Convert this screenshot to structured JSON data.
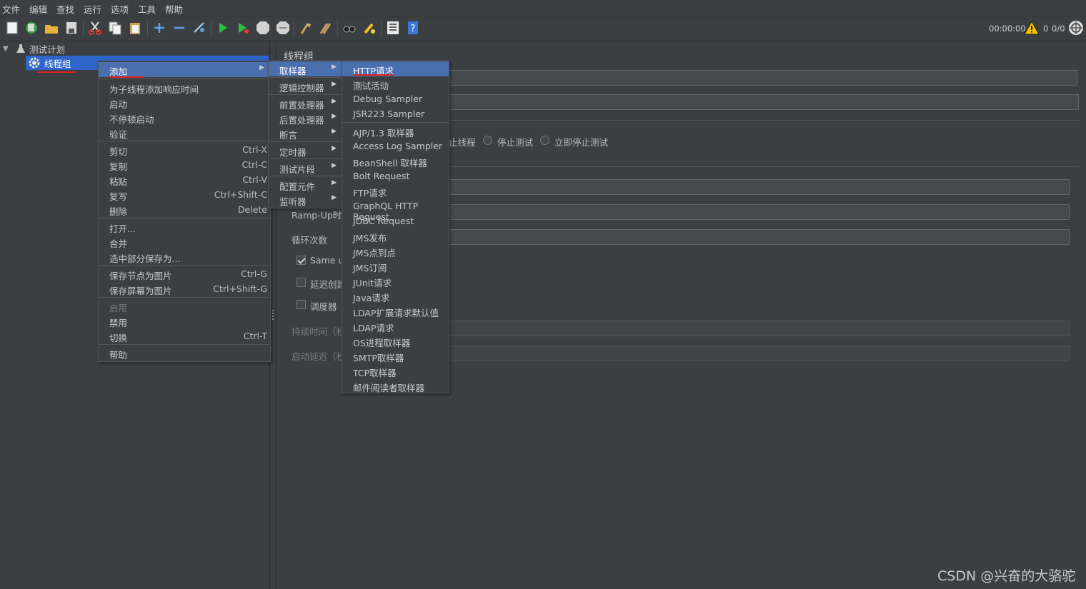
{
  "menubar": [
    "文件",
    "编辑",
    "查找",
    "运行",
    "选项",
    "工具",
    "帮助"
  ],
  "toolbar": {
    "icons": [
      "new-icon",
      "templates-icon",
      "open-icon",
      "save-icon",
      "cut-icon",
      "copy-icon",
      "paste-icon",
      "expand-icon",
      "collapse-icon",
      "toggle-icon",
      "start-icon",
      "start-no-pause-icon",
      "stop-icon",
      "shutdown-icon",
      "clear-icon",
      "clear-all-icon",
      "search-icon",
      "reset-search-icon",
      "function-helper-icon",
      "help-icon"
    ],
    "elapsed_time": "00:00:00",
    "warning_count": "0",
    "thread_ratio": "0/0"
  },
  "tree": {
    "root": "测试计划",
    "child": "线程组"
  },
  "panel": {
    "title": "线程组",
    "radio_stop_thread": "止线程",
    "radio_stop_test": "停止测试",
    "radio_stop_test_now": "立即停止测试",
    "rampup": "Ramp-Up时间",
    "loop": "循环次数",
    "same_user": "Same us",
    "delay_create": "延迟创建",
    "scheduler": "调度器",
    "duration": "持续时间（秒）",
    "startup_delay": "启动延迟（秒）"
  },
  "context_menu": {
    "add": "添加",
    "add_think_time": "为子线程添加响应时间",
    "start": "启动",
    "start_no_pause": "不停顿启动",
    "validate": "验证",
    "cut": "剪切",
    "cut_key": "Ctrl-X",
    "copy": "复制",
    "copy_key": "Ctrl-C",
    "paste": "粘贴",
    "paste_key": "Ctrl-V",
    "duplicate": "复写",
    "duplicate_key": "Ctrl+Shift-C",
    "delete": "删除",
    "delete_key": "Delete",
    "open": "打开...",
    "merge": "合并",
    "save_selection": "选中部分保存为...",
    "save_node_image": "保存节点为图片",
    "save_node_image_key": "Ctrl-G",
    "save_screen_image": "保存屏幕为图片",
    "save_screen_image_key": "Ctrl+Shift-G",
    "enable": "启用",
    "disable": "禁用",
    "toggle": "切换",
    "toggle_key": "Ctrl-T",
    "help": "帮助"
  },
  "add_submenu": [
    "取样器",
    "逻辑控制器",
    "前置处理器",
    "后置处理器",
    "断言",
    "定时器",
    "测试片段",
    "配置元件",
    "监听器"
  ],
  "sampler_submenu": [
    "HTTP请求",
    "测试活动",
    "Debug Sampler",
    "JSR223 Sampler",
    "AJP/1.3 取样器",
    "Access Log Sampler",
    "BeanShell 取样器",
    "Bolt Request",
    "FTP请求",
    "GraphQL HTTP Request",
    "JDBC Request",
    "JMS发布",
    "JMS点到点",
    "JMS订阅",
    "JUnit请求",
    "Java请求",
    "LDAP扩展请求默认值",
    "LDAP请求",
    "OS进程取样器",
    "SMTP取样器",
    "TCP取样器",
    "邮件阅读者取样器"
  ],
  "watermark": "CSDN @兴奋的大骆驼",
  "colors": {
    "background": "#3c3f41",
    "highlight": "#4b6eaf",
    "annotation": "#e02020"
  }
}
